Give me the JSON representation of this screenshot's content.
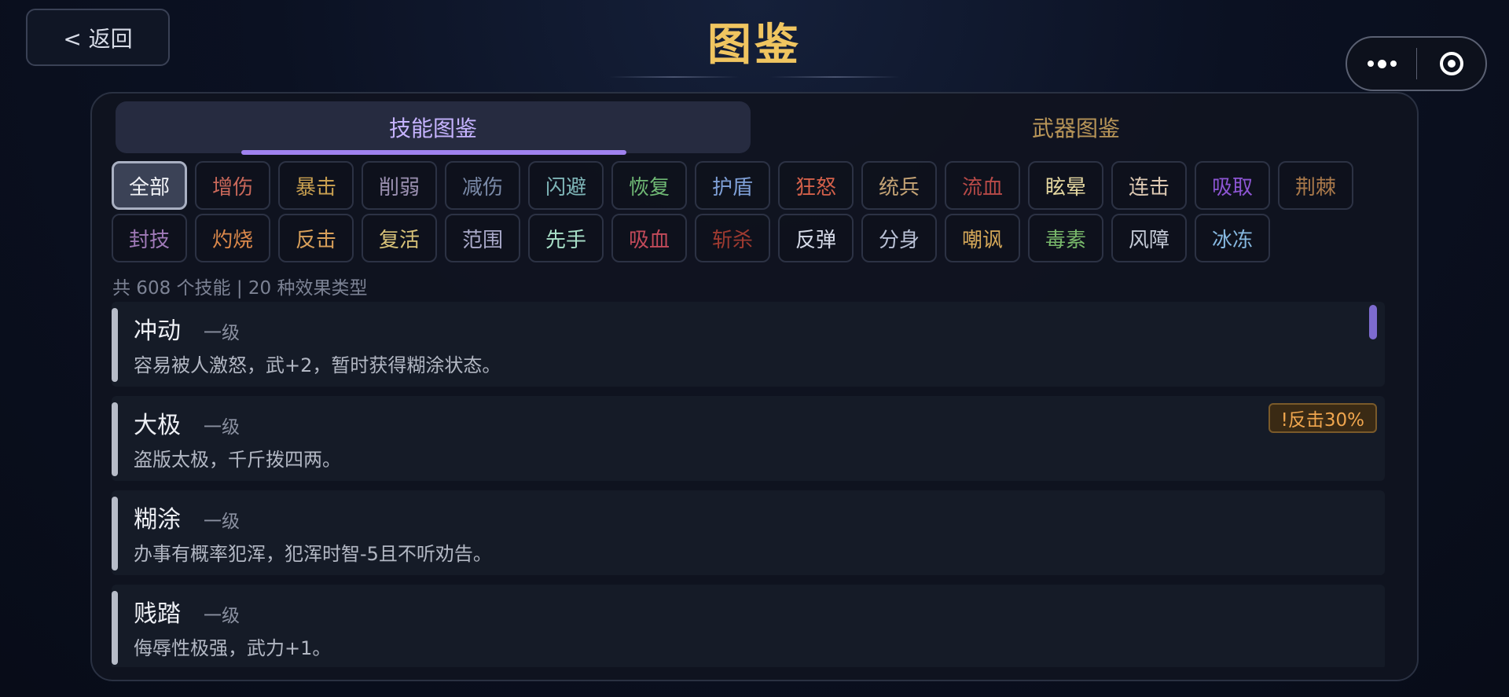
{
  "header": {
    "back_label": "< 返回",
    "title": "图鉴"
  },
  "tabs": [
    {
      "label": "技能图鉴",
      "active": true
    },
    {
      "label": "武器图鉴",
      "active": false
    }
  ],
  "filters": [
    {
      "label": "全部",
      "color": "#f3f4f8",
      "selected": true
    },
    {
      "label": "增伤",
      "color": "#c9685a"
    },
    {
      "label": "暴击",
      "color": "#c9a050"
    },
    {
      "label": "削弱",
      "color": "#9a8fb0"
    },
    {
      "label": "减伤",
      "color": "#7a8aa8"
    },
    {
      "label": "闪避",
      "color": "#7fb6b8"
    },
    {
      "label": "恢复",
      "color": "#6fb874"
    },
    {
      "label": "护盾",
      "color": "#7e9fd6"
    },
    {
      "label": "狂怒",
      "color": "#d3604a"
    },
    {
      "label": "统兵",
      "color": "#c3a274"
    },
    {
      "label": "流血",
      "color": "#b84a48"
    },
    {
      "label": "眩晕",
      "color": "#e4d7a0"
    },
    {
      "label": "连击",
      "color": "#dcc8b2"
    },
    {
      "label": "吸取",
      "color": "#8c55d2"
    },
    {
      "label": "荆棘",
      "color": "#a8784a"
    },
    {
      "label": "封技",
      "color": "#a07ab8"
    },
    {
      "label": "灼烧",
      "color": "#d9874a"
    },
    {
      "label": "反击",
      "color": "#d9a05a"
    },
    {
      "label": "复活",
      "color": "#d8c278"
    },
    {
      "label": "范围",
      "color": "#a9a9c9"
    },
    {
      "label": "先手",
      "color": "#a8e0c8"
    },
    {
      "label": "吸血",
      "color": "#c24a5a"
    },
    {
      "label": "斩杀",
      "color": "#9e3a30"
    },
    {
      "label": "反弹",
      "color": "#d6dbe8"
    },
    {
      "label": "分身",
      "color": "#b8c0d4"
    },
    {
      "label": "嘲讽",
      "color": "#d6a858"
    },
    {
      "label": "毒素",
      "color": "#78b86a"
    },
    {
      "label": "风障",
      "color": "#c2c8d4"
    },
    {
      "label": "冰冻",
      "color": "#86b8e0"
    }
  ],
  "summary": "共 608 个技能 | 20 种效果类型",
  "skills": [
    {
      "name": "冲动",
      "level": "一级",
      "desc": "容易被人激怒，武+2，暂时获得糊涂状态。",
      "tag": ""
    },
    {
      "name": "大极",
      "level": "一级",
      "desc": "盗版太极，千斤拨四两。",
      "tag": "!反击30%"
    },
    {
      "name": "糊涂",
      "level": "一级",
      "desc": "办事有概率犯浑，犯浑时智-5且不听劝告。",
      "tag": ""
    },
    {
      "name": "贱踏",
      "level": "一级",
      "desc": "侮辱性极强，武力+1。",
      "tag": ""
    }
  ],
  "colors": {
    "title": "#f0c560",
    "active_tab": "#c6b3ff",
    "inactive_tab": "#b89558",
    "accent": "#9f82f0",
    "tag_text": "#f0a64e"
  }
}
